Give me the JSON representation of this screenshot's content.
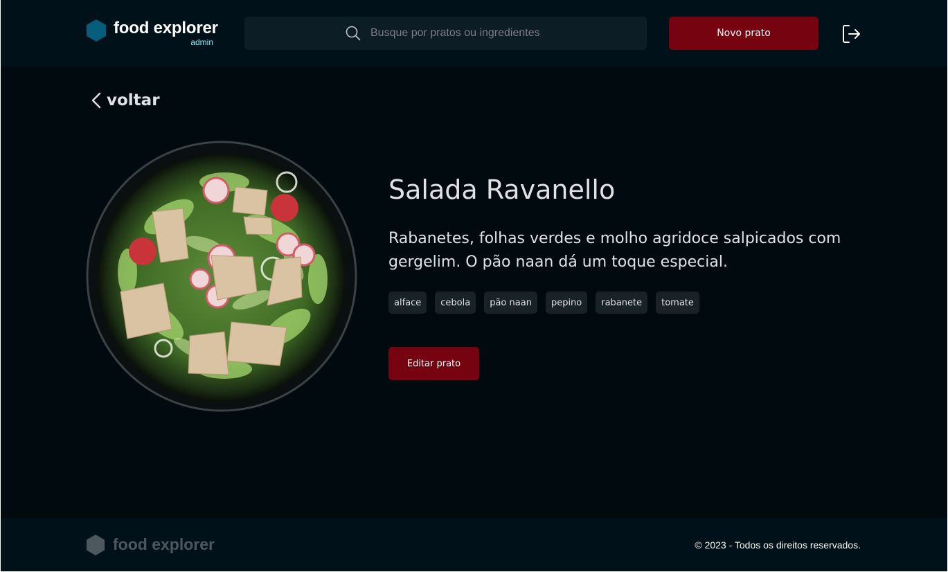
{
  "brand": {
    "name": "food explorer",
    "role": "admin",
    "icon": "hexagon-icon",
    "accent": "#065E7C"
  },
  "search": {
    "placeholder": "Busque por pratos ou ingredientes",
    "icon": "search-icon"
  },
  "header": {
    "new_dish_label": "Novo prato",
    "logout_icon": "logout-icon"
  },
  "back": {
    "label": "voltar",
    "icon": "chevron-left-icon"
  },
  "dish": {
    "title": "Salada Ravanello",
    "description": "Rabanetes, folhas verdes e molho agridoce salpicados com gergelim. O pão naan dá um toque especial.",
    "ingredients": [
      "alface",
      "cebola",
      "pão naan",
      "pepino",
      "rabanete",
      "tomate"
    ],
    "edit_label": "Editar prato"
  },
  "footer": {
    "name": "food explorer",
    "copyright": "© 2023 - Todos os direitos reservados."
  },
  "colors": {
    "background": "#000A0F",
    "header": "#00111A",
    "button": "#750310",
    "tag": "#192227",
    "admin": "#82F3FF"
  }
}
